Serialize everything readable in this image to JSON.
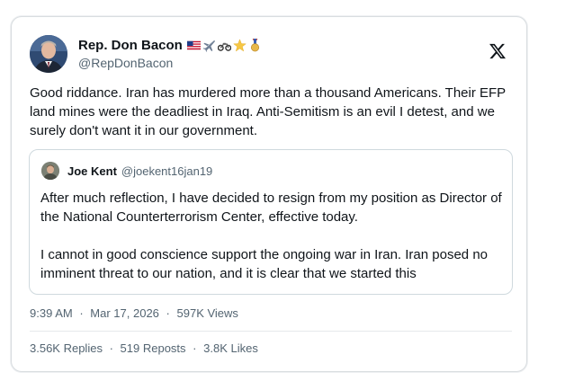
{
  "author": {
    "display_name": "Rep. Don Bacon",
    "handle": "@RepDonBacon",
    "badges": [
      "us-flag-icon",
      "airplane-icon",
      "motorcycle-icon",
      "star-icon",
      "medal-icon"
    ]
  },
  "platform_icon": "x-logo-icon",
  "tweet": {
    "text": "Good riddance. Iran has murdered more than a thousand Americans. Their EFP land mines were the deadliest in Iraq. Anti-Semitism is an evil I detest, and we surely don't want it in our government."
  },
  "quoted_tweet": {
    "display_name": "Joe Kent",
    "handle": "@joekent16jan19",
    "paragraph_1": "After much reflection, I have decided to resign from my position as Director of the National Counterterrorism Center, effective today.",
    "paragraph_2": "I cannot in good conscience support the ongoing war in Iran. Iran posed no imminent threat to our nation, and it is clear that we started this"
  },
  "meta": {
    "time": "9:39 AM",
    "date": "Mar 17, 2026",
    "views": "597K Views",
    "separator": "·"
  },
  "stats": {
    "replies": "3.56K Replies",
    "reposts": "519 Reposts",
    "likes": "3.8K Likes"
  },
  "colors": {
    "text": "#0f1419",
    "muted": "#536471",
    "border": "#cfd9de"
  }
}
